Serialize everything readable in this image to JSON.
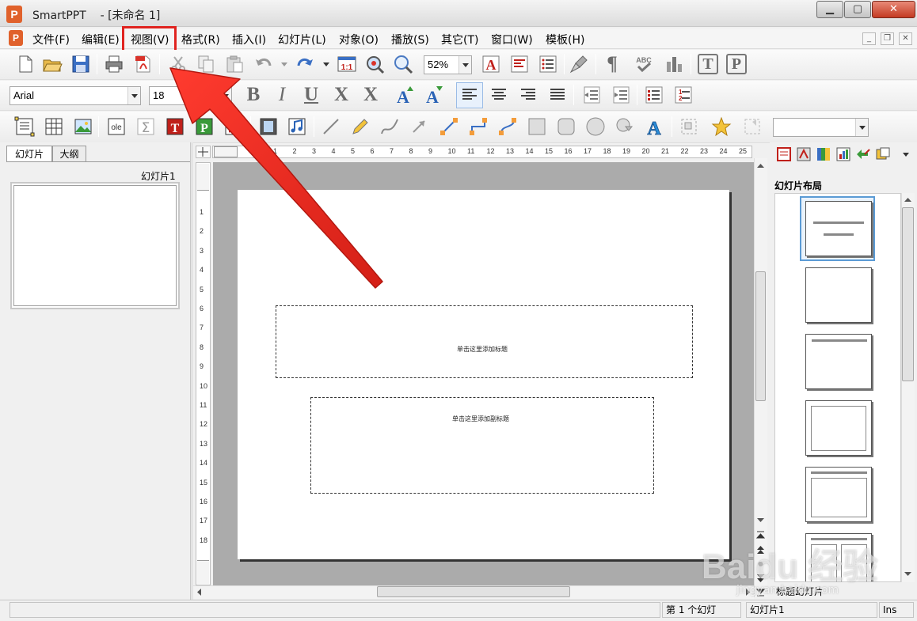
{
  "window": {
    "app_name": "SmartPPT",
    "title": "SmartPPT    - [未命名 1]",
    "logo_letter": "P"
  },
  "menu": [
    {
      "label": "文件(F)"
    },
    {
      "label": "编辑(E)"
    },
    {
      "label": "视图(V)"
    },
    {
      "label": "格式(R)"
    },
    {
      "label": "插入(I)"
    },
    {
      "label": "幻灯片(L)"
    },
    {
      "label": "对象(O)"
    },
    {
      "label": "播放(S)"
    },
    {
      "label": "其它(T)"
    },
    {
      "label": "窗口(W)"
    },
    {
      "label": "模板(H)"
    }
  ],
  "highlighted_menu": "视图(V)",
  "toolbar1": {
    "zoom_value": "52%"
  },
  "toolbar2": {
    "font_name": "Arial",
    "font_size": "18"
  },
  "toolbar3": {
    "style_combo_value": ""
  },
  "left_panel": {
    "tabs": [
      {
        "label": "幻灯片"
      },
      {
        "label": "大纲"
      }
    ],
    "slide_label": "幻灯片1"
  },
  "ruler": {
    "h_ticks": [
      "1",
      "2",
      "3",
      "4",
      "5",
      "6",
      "7",
      "8",
      "9",
      "10",
      "11",
      "12",
      "13",
      "14",
      "15",
      "16",
      "17",
      "18",
      "19",
      "20",
      "21",
      "22",
      "23",
      "24",
      "25"
    ],
    "v_ticks": [
      "1",
      "2",
      "3",
      "4",
      "5",
      "6",
      "7",
      "8",
      "9",
      "10",
      "11",
      "12",
      "13",
      "14",
      "15",
      "16",
      "17",
      "18"
    ]
  },
  "slide": {
    "title_placeholder": "单击这里添加标题",
    "subtitle_placeholder": "单击这里添加副标题"
  },
  "right_panel": {
    "title": "幻灯片布局",
    "caption": "标题幻灯片"
  },
  "statusbar": {
    "slide_count": "第 1 个幻灯",
    "slide_name": "幻灯片1",
    "mode": "Ins"
  },
  "watermark": {
    "main": "Baidu 经验",
    "sub": "jingyan.baidu.com"
  },
  "colors": {
    "highlight": "#e0231f",
    "arrow": "#e8281f",
    "logo": "#e0612b"
  }
}
